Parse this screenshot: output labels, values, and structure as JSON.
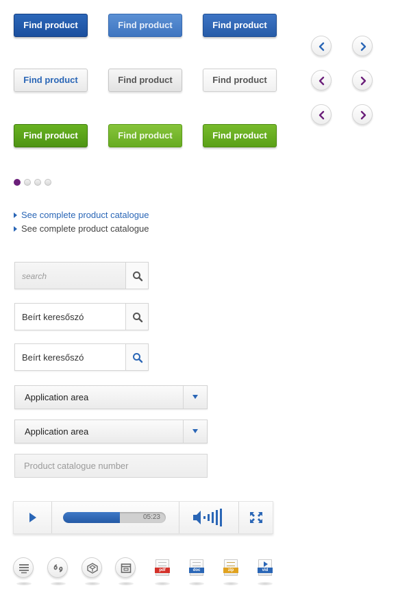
{
  "buttons": {
    "row1": [
      "Find product",
      "Find product",
      "Find product"
    ],
    "row2": [
      "Find product",
      "Find product",
      "Find product"
    ],
    "row3": [
      "Find product",
      "Find product",
      "Find product"
    ]
  },
  "nav_arrows": {
    "blue": {
      "color": "#2a66b6",
      "icons": [
        "chevron-left-icon",
        "chevron-right-icon"
      ]
    },
    "purple": {
      "color": "#6b1f7a",
      "icons": [
        "chevron-left-icon",
        "chevron-right-icon"
      ]
    }
  },
  "pagination": {
    "count": 4,
    "active_index": 0,
    "active_color": "#6b1f7a"
  },
  "links": [
    {
      "label": "See complete product catalogue",
      "color": "#2a66b6"
    },
    {
      "label": "See complete product catalogue",
      "color": "#444444"
    }
  ],
  "search_boxes": [
    {
      "value": "",
      "placeholder": "search"
    },
    {
      "value": "Beírt keresőszó",
      "placeholder": ""
    },
    {
      "value": "Beírt keresőszó",
      "placeholder": ""
    }
  ],
  "dropdowns": [
    {
      "selected": "Application area"
    },
    {
      "selected": "Application area"
    }
  ],
  "catalogue_field": {
    "placeholder": "Product catalogue number"
  },
  "player": {
    "time": "05:23",
    "progress": 0.55
  },
  "file_icons": [
    {
      "icon": "list-icon",
      "label": ""
    },
    {
      "icon": "quote-icon",
      "label": ""
    },
    {
      "icon": "cube-icon",
      "label": ""
    },
    {
      "icon": "window-icon",
      "label": ""
    },
    {
      "icon": "pdf-file-icon",
      "label": "pdf",
      "color": "#d4312a"
    },
    {
      "icon": "doc-file-icon",
      "label": "doc",
      "color": "#2a66b6"
    },
    {
      "icon": "zip-file-icon",
      "label": "zip",
      "color": "#e0a21f"
    },
    {
      "icon": "video-file-icon",
      "label": "vid",
      "color": "#2a66b6"
    }
  ],
  "colors": {
    "primary_blue": "#1b4f9e",
    "accent_green": "#4e9414",
    "accent_purple": "#6b1f7a"
  }
}
